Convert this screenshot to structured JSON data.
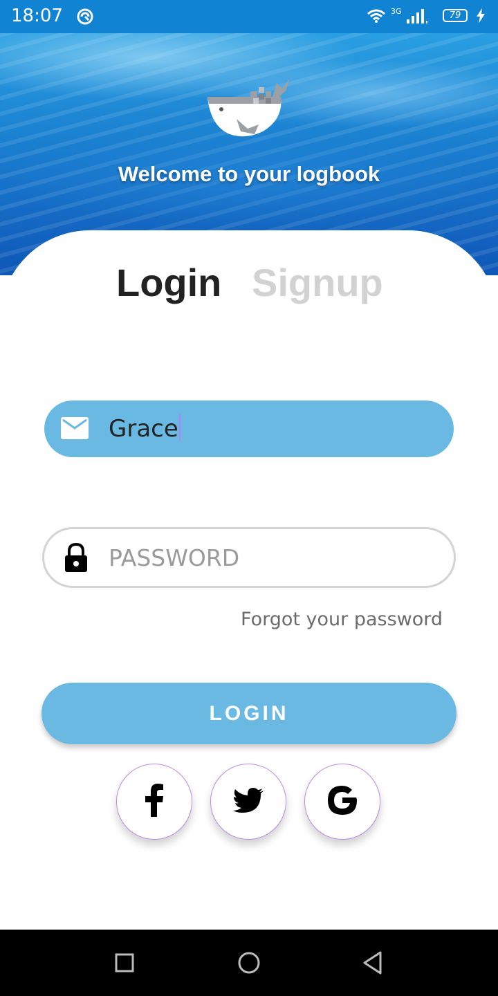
{
  "status_bar": {
    "time": "18:07",
    "network": "3G",
    "battery": "79"
  },
  "hero": {
    "title": "Welcome to your logbook"
  },
  "tabs": {
    "login": "Login",
    "signup": "Signup"
  },
  "form": {
    "email_value": "Grace",
    "password_placeholder": "PASSWORD",
    "forgot_link": "Forgot your password",
    "login_button": "LOGIN"
  },
  "social": [
    "facebook",
    "twitter",
    "google"
  ],
  "colors": {
    "status_bar": "#1183d3",
    "accent": "#69b9e2",
    "tab_active": "#222222",
    "tab_inactive": "#d2d2d2"
  }
}
